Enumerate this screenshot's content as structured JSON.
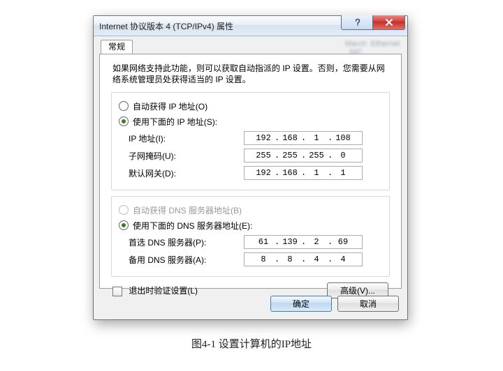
{
  "window": {
    "title": "Internet 协议版本 4 (TCP/IPv4) 属性"
  },
  "tab": {
    "general": "常规"
  },
  "desc": "如果网络支持此功能，则可以获取自动指派的 IP 设置。否则，您需要从网络系统管理员处获得适当的 IP 设置。",
  "ip": {
    "auto": "自动获得 IP 地址(O)",
    "manual": "使用下面的 IP 地址(S):",
    "fields": {
      "addr": {
        "label": "IP 地址(I):",
        "v": [
          "192",
          "168",
          "1",
          "108"
        ]
      },
      "mask": {
        "label": "子网掩码(U):",
        "v": [
          "255",
          "255",
          "255",
          "0"
        ]
      },
      "gw": {
        "label": "默认网关(D):",
        "v": [
          "192",
          "168",
          "1",
          "1"
        ]
      }
    }
  },
  "dns": {
    "auto": "自动获得 DNS 服务器地址(B)",
    "manual": "使用下面的 DNS 服务器地址(E):",
    "fields": {
      "pref": {
        "label": "首选 DNS 服务器(P):",
        "v": [
          "61",
          "139",
          "2",
          "69"
        ]
      },
      "alt": {
        "label": "备用 DNS 服务器(A):",
        "v": [
          "8",
          "8",
          "4",
          "4"
        ]
      }
    }
  },
  "validate": "退出时验证设置(L)",
  "buttons": {
    "advanced": "高级(V)...",
    "ok": "确定",
    "cancel": "取消"
  },
  "caption": "图4-1  设置计算机的IP地址"
}
